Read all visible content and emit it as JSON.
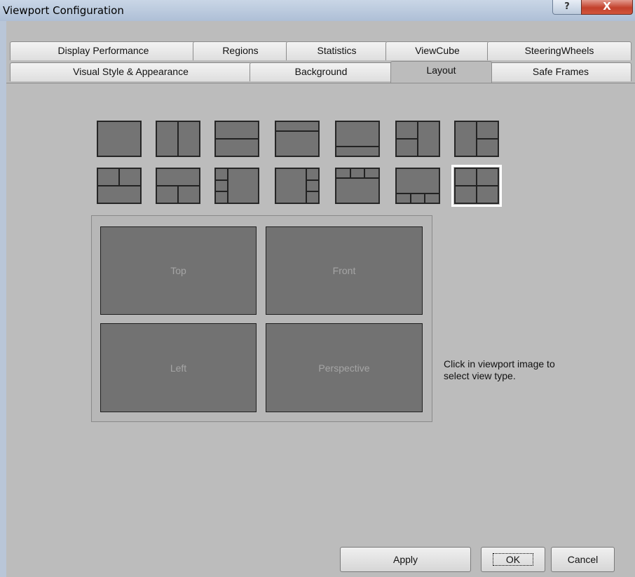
{
  "window": {
    "title": "Viewport Configuration",
    "help_glyph": "?",
    "close_glyph": "X"
  },
  "tabs_row1": [
    "Display Performance",
    "Regions",
    "Statistics",
    "ViewCube",
    "SteeringWheels"
  ],
  "tabs_row2": [
    "Visual Style & Appearance",
    "Background",
    "Layout",
    "Safe Frames"
  ],
  "active_tab": "Layout",
  "layouts": {
    "selected_index": 13,
    "count": 14
  },
  "preview": {
    "viewports": [
      "Top",
      "Front",
      "Left",
      "Perspective"
    ]
  },
  "hint_text": "Click in viewport image to select view type.",
  "buttons": {
    "apply": "Apply",
    "ok": "OK",
    "cancel": "Cancel"
  },
  "colors": {
    "background": "#bcbcbc",
    "pane": "#747474",
    "selected_outline": "#ffffff"
  }
}
